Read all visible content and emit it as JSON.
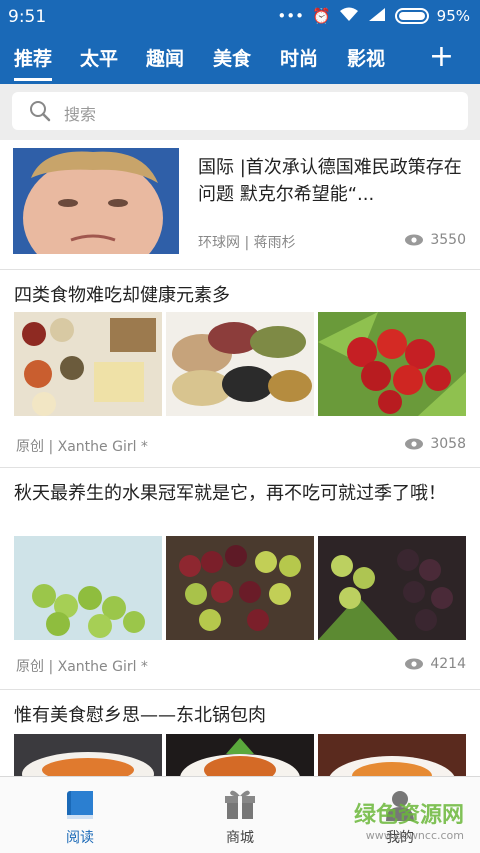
{
  "status": {
    "time": "9:51",
    "battery": "95%"
  },
  "tabs": [
    {
      "label": "推荐",
      "active": true
    },
    {
      "label": "太平"
    },
    {
      "label": "趣闻"
    },
    {
      "label": "美食"
    },
    {
      "label": "时尚"
    },
    {
      "label": "影视"
    }
  ],
  "add_tab_icon": "plus-icon",
  "search": {
    "placeholder": "搜索"
  },
  "articles": [
    {
      "title": "国际 |首次承认德国难民政策存在问题 默克尔希望能“...",
      "source": "环球网",
      "author": "蒋雨杉",
      "views": "3550"
    },
    {
      "title": "四类食物难吃却健康元素多",
      "source": "原创",
      "author": "Xanthe  Girl *",
      "views": "3058"
    },
    {
      "title": "秋天最养生的水果冠军就是它，再不吃可就过季了哦！",
      "source": "原创",
      "author": "Xanthe  Girl *",
      "views": "4214"
    },
    {
      "title": "惟有美食慰乡思——东北锅包肉"
    }
  ],
  "bottom_nav": [
    {
      "label": "阅读",
      "icon": "book-icon",
      "active": true
    },
    {
      "label": "商城",
      "icon": "gift-icon"
    },
    {
      "label": "我的",
      "icon": "user-icon"
    }
  ],
  "watermark": {
    "text": "绿色资源网",
    "url": "www.downcc.com"
  },
  "colors": {
    "brand": "#1a69b7",
    "watermark": "#6bb83a"
  }
}
